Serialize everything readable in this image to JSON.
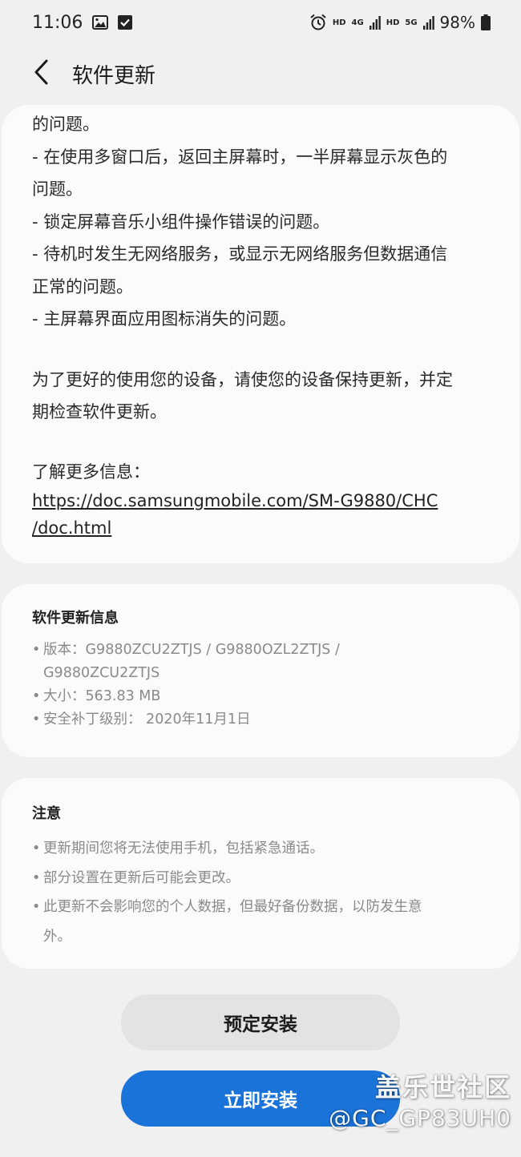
{
  "status_bar": {
    "time": "11:06",
    "network_hd1": "HD",
    "network_4g": "4G",
    "network_hd2": "HD",
    "network_5g": "5G",
    "battery": "98%"
  },
  "header": {
    "title": "软件更新"
  },
  "notes": {
    "lines": [
      "的问题。",
      "- 在使用多窗口后，返回主屏幕时，一半屏幕显示灰色的",
      "问题。",
      "- 锁定屏幕音乐小组件操作错误的问题。",
      "- 待机时发生无网络服务，或显示无网络服务但数据通信",
      "正常的问题。",
      "- 主屏幕界面应用图标消失的问题。"
    ],
    "keep_updated": [
      "为了更好的使用您的设备，请使您的设备保持更新，并定",
      "期检查软件更新。"
    ],
    "more_label": "了解更多信息：",
    "link_line1": "https://doc.samsungmobile.com/SM-G9880/CHC",
    "link_line2": "/doc.html"
  },
  "update_info": {
    "title": "软件更新信息",
    "version_line1": "版本：G9880ZCU2ZTJS / G9880OZL2ZTJS /",
    "version_line2": "G9880ZCU2ZTJS",
    "size": "大小：563.83 MB",
    "patch": "安全补丁级别： 2020年11月1日"
  },
  "caution": {
    "title": "注意",
    "items": [
      "更新期间您将无法使用手机，包括紧急通话。",
      "部分设置在更新后可能会更改。",
      "此更新不会影响您的个人数据，但最好备份数据，以防发生意"
    ],
    "item3_cont": "外。"
  },
  "buttons": {
    "schedule": "预定安装",
    "install_now": "立即安装"
  },
  "watermark": {
    "line1": "盖乐世社区",
    "line2": "@GC_GP83UH0"
  },
  "colors": {
    "background": "#f0f0f0",
    "card": "#fbfbfb",
    "primary_button": "#1a73d9",
    "secondary_button": "#e3e3e3"
  },
  "icons": {
    "status_left": [
      "image-icon",
      "checkbox-icon"
    ],
    "status_right": [
      "alarm-icon",
      "signal-icon",
      "signal-icon",
      "battery-icon"
    ],
    "header": [
      "back-arrow-icon"
    ]
  }
}
